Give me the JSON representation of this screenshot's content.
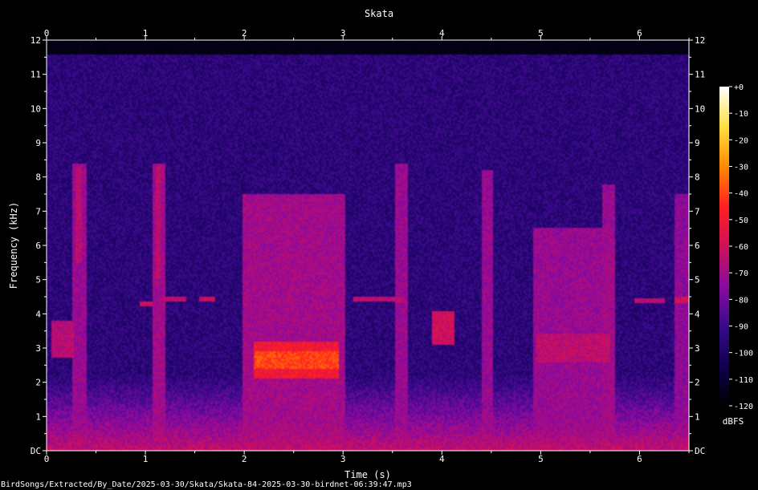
{
  "chart_data": {
    "type": "heatmap",
    "title": "Skata",
    "xlabel": "Time (s)",
    "ylabel": "Frequency (kHz)",
    "xlim": [
      0,
      6.5
    ],
    "ylim": [
      0,
      12
    ],
    "x_ticks": [
      "0",
      "1",
      "2",
      "3",
      "4",
      "5",
      "6"
    ],
    "y_ticks": [
      "DC",
      "1",
      "2",
      "3",
      "4",
      "5",
      "6",
      "7",
      "8",
      "9",
      "10",
      "11",
      "12"
    ],
    "colorbar": {
      "label": "dBFS",
      "range": [
        -120,
        0
      ],
      "ticks": [
        "+0",
        "-10",
        "-20",
        "-30",
        "-40",
        "-50",
        "-60",
        "-70",
        "-80",
        "-90",
        "-100",
        "-110",
        "-120"
      ],
      "colors": [
        "#000000",
        "#100050",
        "#3a0a8c",
        "#8a0aa0",
        "#d0105a",
        "#ff2020",
        "#ff8a00",
        "#ffe040",
        "#ffffff"
      ]
    },
    "noise_ceiling_khz": 11.6,
    "background_level_dbfs": -95,
    "events": [
      {
        "t0": 0.05,
        "t1": 0.28,
        "f0": 2.7,
        "f1": 3.8,
        "level_dbfs": -65
      },
      {
        "t0": 0.26,
        "t1": 0.4,
        "f0": 0.0,
        "f1": 8.4,
        "level_dbfs": -72
      },
      {
        "t0": 0.3,
        "t1": 0.36,
        "f0": 5.5,
        "f1": 8.3,
        "level_dbfs": -65
      },
      {
        "t0": 0.95,
        "t1": 1.08,
        "f0": 4.2,
        "f1": 4.35,
        "level_dbfs": -60
      },
      {
        "t0": 1.07,
        "t1": 1.2,
        "f0": 0.0,
        "f1": 8.4,
        "level_dbfs": -70
      },
      {
        "t0": 1.1,
        "t1": 1.16,
        "f0": 5.0,
        "f1": 8.3,
        "level_dbfs": -64
      },
      {
        "t0": 1.18,
        "t1": 1.42,
        "f0": 4.35,
        "f1": 4.5,
        "level_dbfs": -64
      },
      {
        "t0": 1.55,
        "t1": 1.7,
        "f0": 4.35,
        "f1": 4.5,
        "level_dbfs": -62
      },
      {
        "t0": 1.98,
        "t1": 3.02,
        "f0": 0.0,
        "f1": 7.5,
        "level_dbfs": -70
      },
      {
        "t0": 2.1,
        "t1": 2.95,
        "f0": 2.1,
        "f1": 3.2,
        "level_dbfs": -50
      },
      {
        "t0": 2.1,
        "t1": 2.95,
        "f0": 2.4,
        "f1": 2.9,
        "level_dbfs": -40
      },
      {
        "t0": 3.1,
        "t1": 3.6,
        "f0": 4.35,
        "f1": 4.5,
        "level_dbfs": -65
      },
      {
        "t0": 3.53,
        "t1": 3.65,
        "f0": 0.0,
        "f1": 8.4,
        "level_dbfs": -72
      },
      {
        "t0": 3.9,
        "t1": 4.12,
        "f0": 3.1,
        "f1": 4.1,
        "level_dbfs": -60
      },
      {
        "t0": 4.4,
        "t1": 4.52,
        "f0": 0.0,
        "f1": 8.2,
        "level_dbfs": -72
      },
      {
        "t0": 4.92,
        "t1": 5.75,
        "f0": 0.0,
        "f1": 6.5,
        "level_dbfs": -72
      },
      {
        "t0": 4.95,
        "t1": 5.7,
        "f0": 2.6,
        "f1": 3.4,
        "level_dbfs": -64
      },
      {
        "t0": 5.62,
        "t1": 5.75,
        "f0": 0.0,
        "f1": 7.8,
        "level_dbfs": -72
      },
      {
        "t0": 5.95,
        "t1": 6.25,
        "f0": 4.3,
        "f1": 4.45,
        "level_dbfs": -66
      },
      {
        "t0": 6.35,
        "t1": 6.5,
        "f0": 4.3,
        "f1": 4.5,
        "level_dbfs": -60
      },
      {
        "t0": 6.35,
        "t1": 6.5,
        "f0": 0.0,
        "f1": 7.5,
        "level_dbfs": -74
      }
    ]
  },
  "footer": {
    "file_path": "BirdSongs/Extracted/By_Date/2025-03-30/Skata/Skata-84-2025-03-30-birdnet-06:39:47.mp3"
  }
}
